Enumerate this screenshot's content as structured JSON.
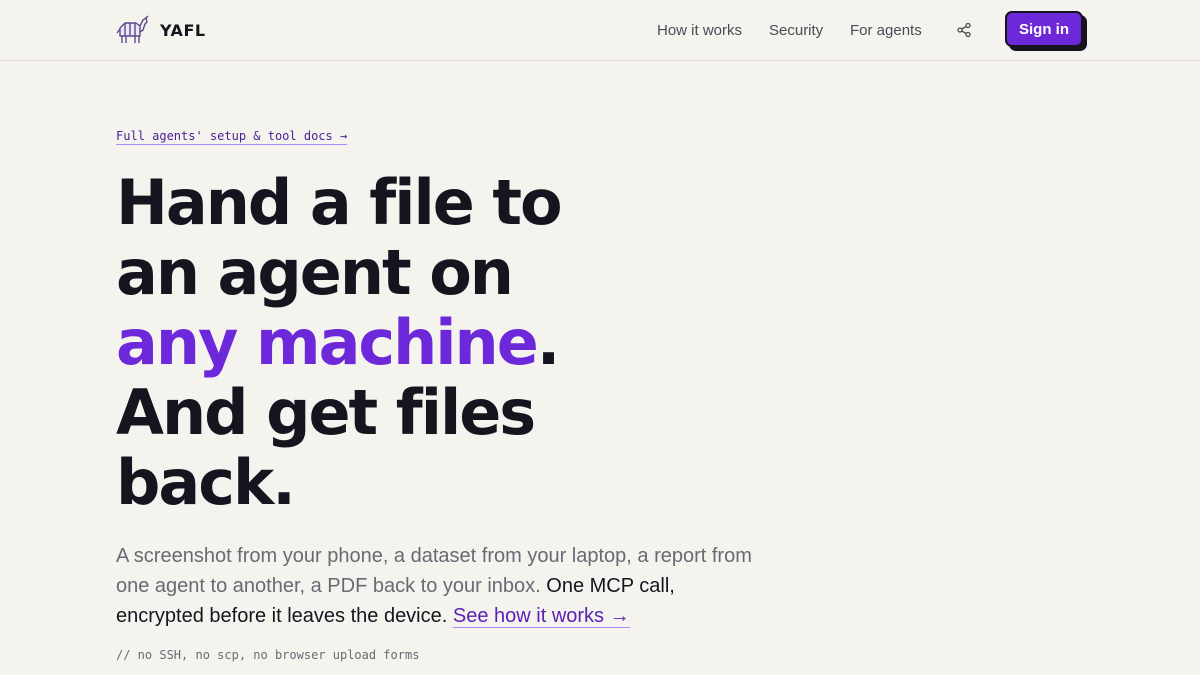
{
  "brand": {
    "name": "YAFL",
    "logo_icon": "pack-animal-logo-icon"
  },
  "nav": {
    "links": [
      "How it works",
      "Security",
      "For agents"
    ],
    "share_icon": "share-icon",
    "signin_label": "Sign in"
  },
  "hero": {
    "docs_link": "Full agents' setup & tool docs →",
    "title_line1": "Hand a file to",
    "title_line2": "an agent on",
    "title_line3_accent": "any machine",
    "title_line3_end": ".",
    "title_line4": "And get files",
    "title_line5": "back.",
    "lead_plain": "A screenshot from your phone, a dataset from your laptop, a report from one agent to another, a PDF back to your inbox. ",
    "lead_strong": "One MCP call, encrypted before it leaves the device.",
    "lead_link": "See how it works →",
    "note": "// no SSH, no scp, no browser upload forms"
  },
  "colors": {
    "accent": "#6d28d9",
    "background": "#f5f3ee",
    "text": "#16141f"
  }
}
